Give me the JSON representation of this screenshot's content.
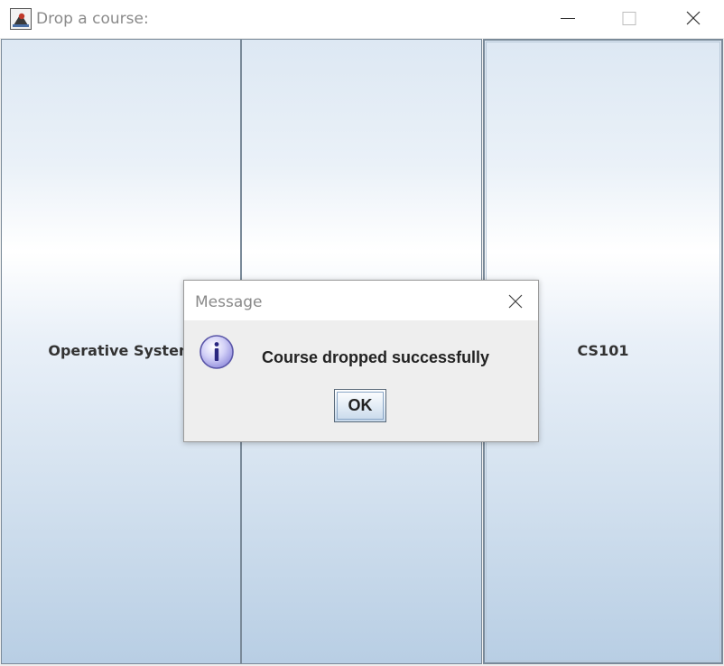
{
  "window": {
    "title": "Drop a course:",
    "icons": [
      "java-app-icon",
      "minimize-icon",
      "maximize-icon",
      "close-icon"
    ]
  },
  "courses": [
    {
      "label": "Operative System"
    },
    {
      "label": ""
    },
    {
      "label": "CS101"
    }
  ],
  "dialog": {
    "title": "Message",
    "message": "Course dropped successfully",
    "ok_label": "OK",
    "icon": "information-icon"
  },
  "colors": {
    "info_icon": "#b9b6f0",
    "button_gradient_top": "#ffffff",
    "button_gradient_bottom": "#b8cee4"
  }
}
